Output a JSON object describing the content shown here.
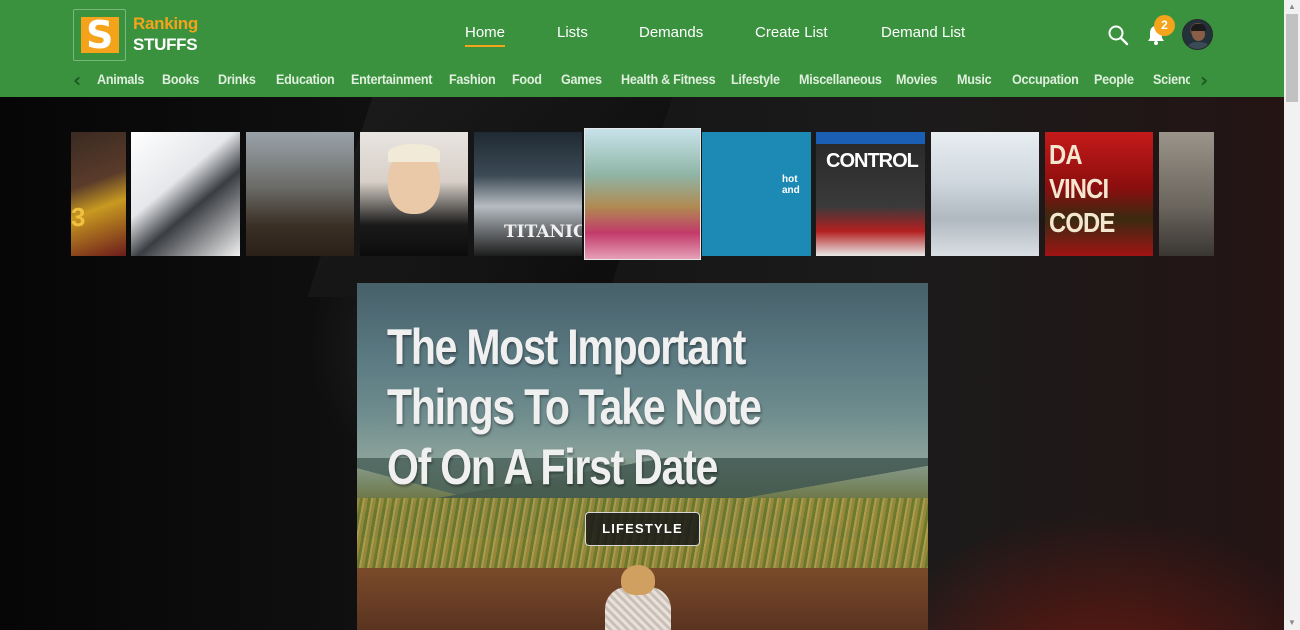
{
  "brand": {
    "line1": "Ranking",
    "line2": "STUFFS",
    "mark": "S",
    "accent": "#f4a31a",
    "primary": "#3a923e"
  },
  "nav": {
    "items": [
      "Home",
      "Lists",
      "Demands",
      "Create List",
      "Demand List"
    ],
    "active": "Home"
  },
  "header_icons": {
    "search": "search-icon",
    "notifications": "bell-icon",
    "notification_count": "2",
    "avatar": "user-avatar"
  },
  "categories": [
    "Animals",
    "Books",
    "Drinks",
    "Education",
    "Entertainment",
    "Fashion",
    "Food",
    "Games",
    "Health & Fitness",
    "Lifestyle",
    "Miscellaneous",
    "Movies",
    "Music",
    "Occupation",
    "People",
    "Science"
  ],
  "carousel": {
    "thumbnails": [
      {
        "subject": "basketball-player",
        "text": "3"
      },
      {
        "subject": "microscopes",
        "text": ""
      },
      {
        "subject": "statues",
        "text": ""
      },
      {
        "subject": "eminem-portrait",
        "text": ""
      },
      {
        "subject": "titanic-poster",
        "text": "TITANIC"
      },
      {
        "subject": "woman-picnic",
        "text": ""
      },
      {
        "subject": "covid-info",
        "text": "hot and"
      },
      {
        "subject": "control-game",
        "text": "CONTROL"
      },
      {
        "subject": "graduation-caps",
        "text": ""
      },
      {
        "subject": "da-vinci-code",
        "text": "DA VINCI CODE"
      },
      {
        "subject": "stone-face",
        "text": ""
      }
    ]
  },
  "hero": {
    "title": "The Most Important Things To Take Note Of On A First Date",
    "category": "LIFESTYLE"
  }
}
